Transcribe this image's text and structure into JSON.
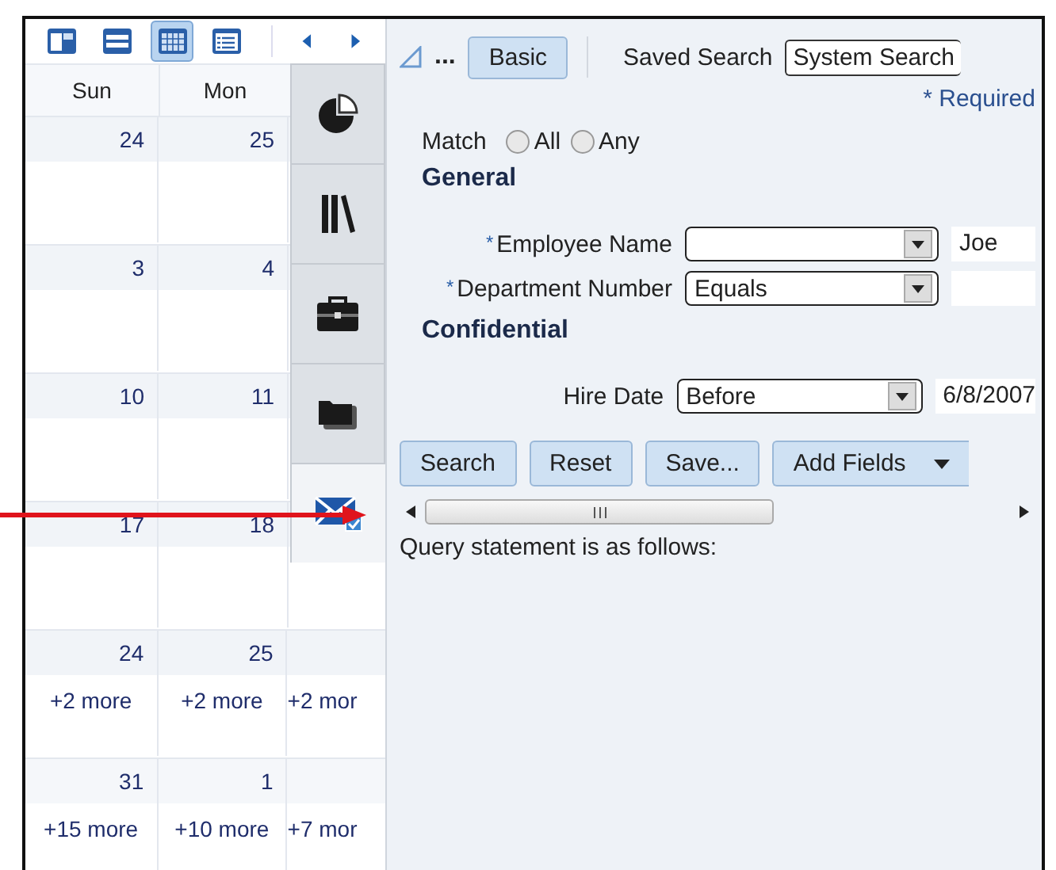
{
  "calendar": {
    "view_buttons": [
      {
        "kind": "day",
        "selected": false
      },
      {
        "kind": "week",
        "selected": false
      },
      {
        "kind": "month",
        "selected": true
      },
      {
        "kind": "list",
        "selected": false
      }
    ],
    "day_headers": [
      "Sun",
      "Mon"
    ],
    "weeks": [
      {
        "cells": [
          {
            "date": "24"
          },
          {
            "date": "25"
          }
        ]
      },
      {
        "cells": [
          {
            "date": "3"
          },
          {
            "date": "4"
          }
        ]
      },
      {
        "cells": [
          {
            "date": "10"
          },
          {
            "date": "11"
          }
        ]
      },
      {
        "cells": [
          {
            "date": "17"
          },
          {
            "date": "18"
          }
        ]
      },
      {
        "cells": [
          {
            "date": "24",
            "more": "+2 more"
          },
          {
            "date": "25",
            "more": "+2 more"
          },
          {
            "more": "+2 mor"
          }
        ]
      },
      {
        "cells": [
          {
            "date": "31",
            "more": "+15 more"
          },
          {
            "date": "1",
            "more": "+10 more"
          },
          {
            "more": "+7 mor"
          }
        ]
      }
    ]
  },
  "side_tabs": [
    {
      "kind": "chart",
      "selected": false
    },
    {
      "kind": "books",
      "selected": false
    },
    {
      "kind": "briefcase",
      "selected": false
    },
    {
      "kind": "folder",
      "selected": false
    },
    {
      "kind": "mail",
      "selected": true
    }
  ],
  "search": {
    "ellipsis": "...",
    "mode_button": "Basic",
    "saved_search_label": "Saved Search",
    "saved_search_value": "System Search",
    "required_note": "* Required",
    "match_label": "Match",
    "match_options": [
      {
        "label": "All",
        "checked": false
      },
      {
        "label": "Any",
        "checked": false
      }
    ],
    "sections": [
      {
        "title": "General",
        "fields": [
          {
            "required_mark": "*",
            "label": "Employee Name",
            "value": "Joe"
          },
          {
            "required_mark": "*",
            "label": "Department Number",
            "operator": "Equals"
          }
        ]
      },
      {
        "title": "Confidential",
        "fields": [
          {
            "label": "Hire Date",
            "operator": "Before",
            "value": "6/8/2007"
          }
        ]
      }
    ],
    "buttons": [
      {
        "label": "Search",
        "kind": "plain"
      },
      {
        "label": "Reset",
        "kind": "plain"
      },
      {
        "label": "Save...",
        "kind": "plain"
      },
      {
        "label": "Add Fields",
        "kind": "menu"
      }
    ],
    "query_text": "Query statement is as follows:"
  }
}
